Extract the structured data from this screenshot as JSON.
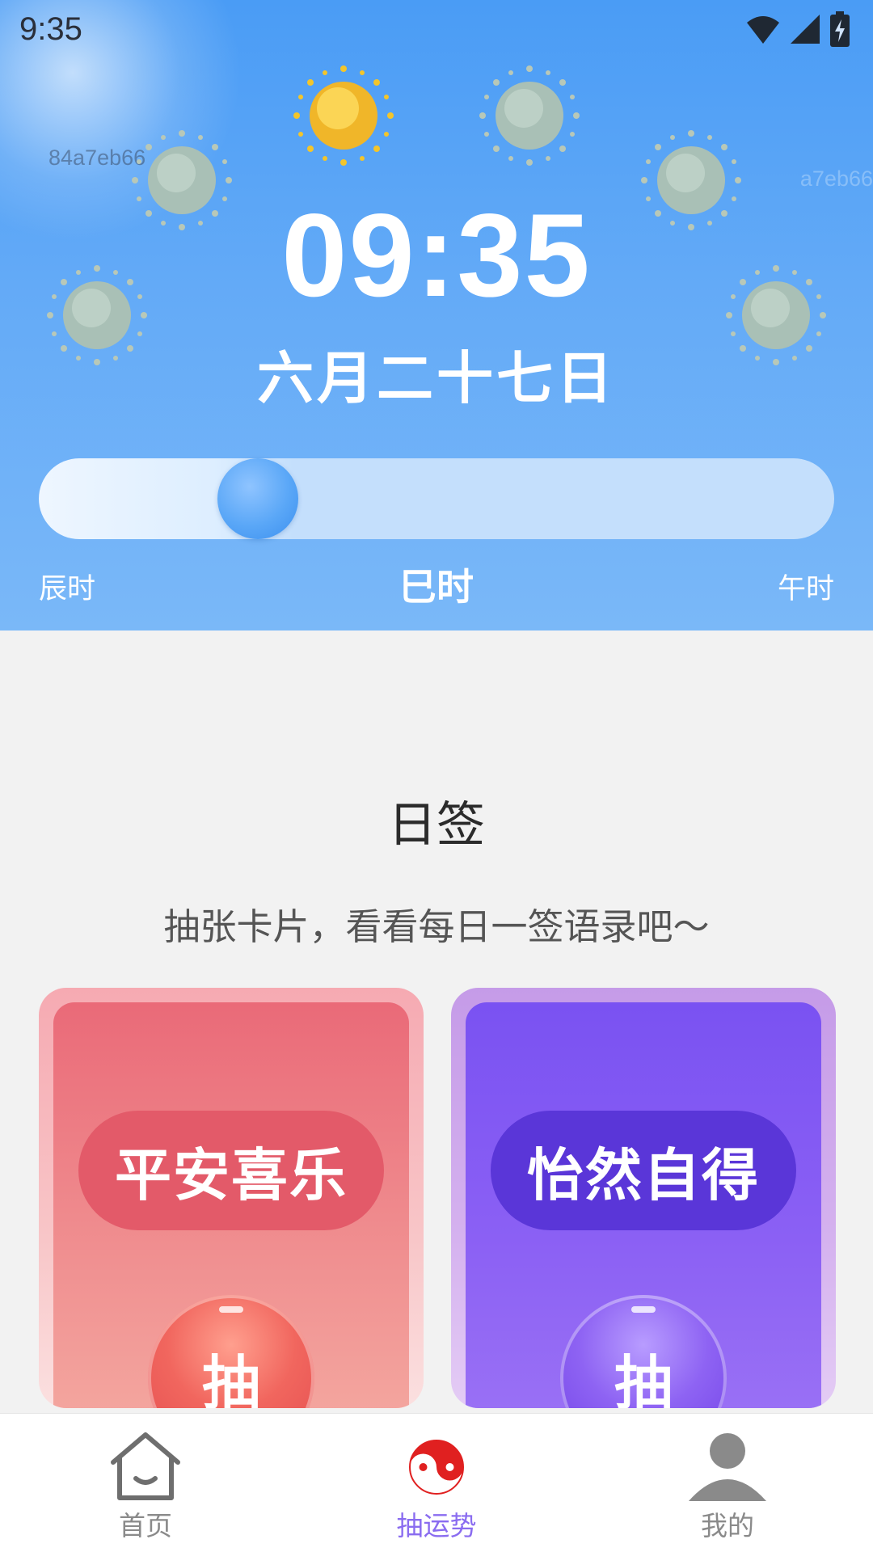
{
  "status_bar": {
    "time": "9:35"
  },
  "watermarks": [
    "84a7eb66",
    "a7eb66"
  ],
  "clock": {
    "time": "09:35",
    "date": "六月二十七日"
  },
  "hour_slider": {
    "previous": "辰时",
    "current": "巳时",
    "next": "午时",
    "progress": 0.25
  },
  "section": {
    "title": "日签",
    "subtitle": "抽张卡片，看看每日一签语录吧～"
  },
  "cards": [
    {
      "title": "平安喜乐",
      "button": "抽",
      "color": "#ea6a78"
    },
    {
      "title": "怡然自得",
      "button": "抽",
      "color": "#7a52f2"
    }
  ],
  "nav": {
    "items": [
      {
        "label": "首页",
        "icon": "home-icon"
      },
      {
        "label": "抽运势",
        "icon": "yin-yang-icon",
        "active": true
      },
      {
        "label": "我的",
        "icon": "profile-icon"
      }
    ]
  },
  "colors": {
    "header_top": "#4a9cf5",
    "accent_active": "#8a6cf0",
    "yin_yang_red": "#e02020"
  }
}
